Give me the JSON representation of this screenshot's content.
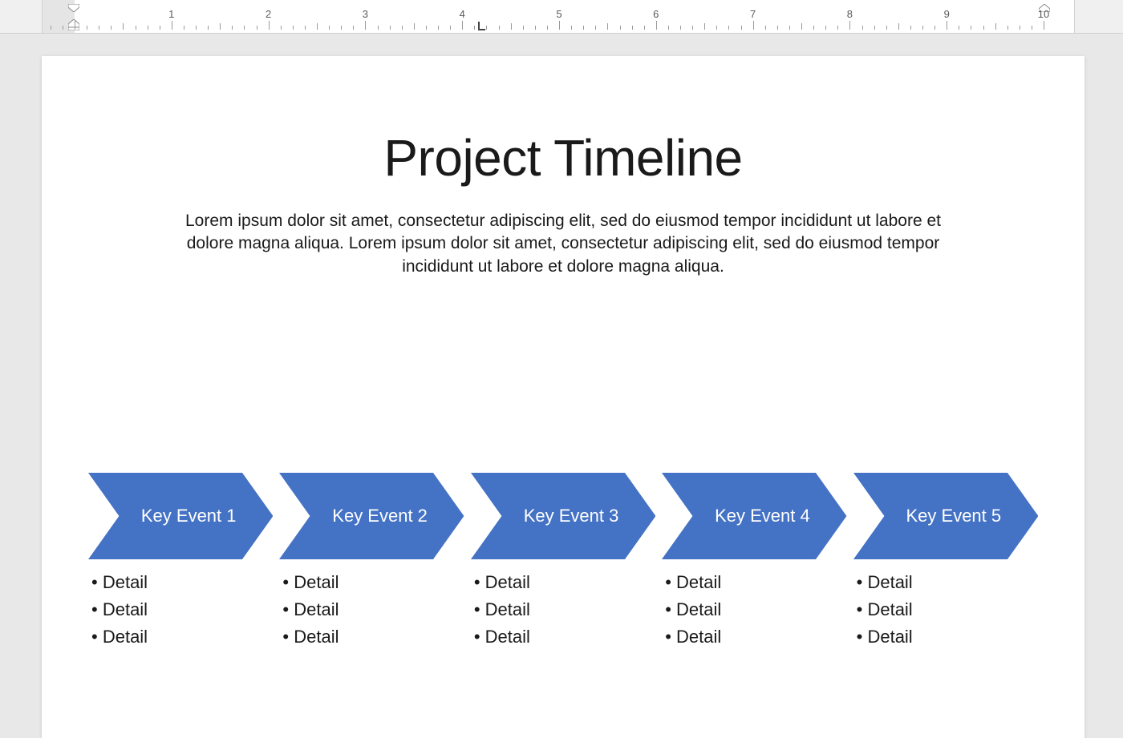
{
  "ruler": {
    "numbers": [
      "1",
      "2",
      "3",
      "4",
      "5",
      "6",
      "7",
      "8",
      "9",
      "10"
    ]
  },
  "slide": {
    "title": "Project Timeline",
    "description": "Lorem ipsum dolor sit amet, consectetur adipiscing elit, sed do eiusmod tempor incididunt ut labore et dolore magna aliqua. Lorem ipsum dolor sit amet, consectetur adipiscing elit, sed do eiusmod tempor incididunt ut labore et dolore magna aliqua."
  },
  "timeline": {
    "chevron_fill": "#4472c4",
    "steps": [
      {
        "label": "Key Event 1",
        "details": [
          "Detail",
          "Detail",
          "Detail"
        ]
      },
      {
        "label": "Key Event 2",
        "details": [
          "Detail",
          "Detail",
          "Detail"
        ]
      },
      {
        "label": "Key Event 3",
        "details": [
          "Detail",
          "Detail",
          "Detail"
        ]
      },
      {
        "label": "Key Event 4",
        "details": [
          "Detail",
          "Detail",
          "Detail"
        ]
      },
      {
        "label": "Key Event 5",
        "details": [
          "Detail",
          "Detail",
          "Detail"
        ]
      }
    ]
  }
}
